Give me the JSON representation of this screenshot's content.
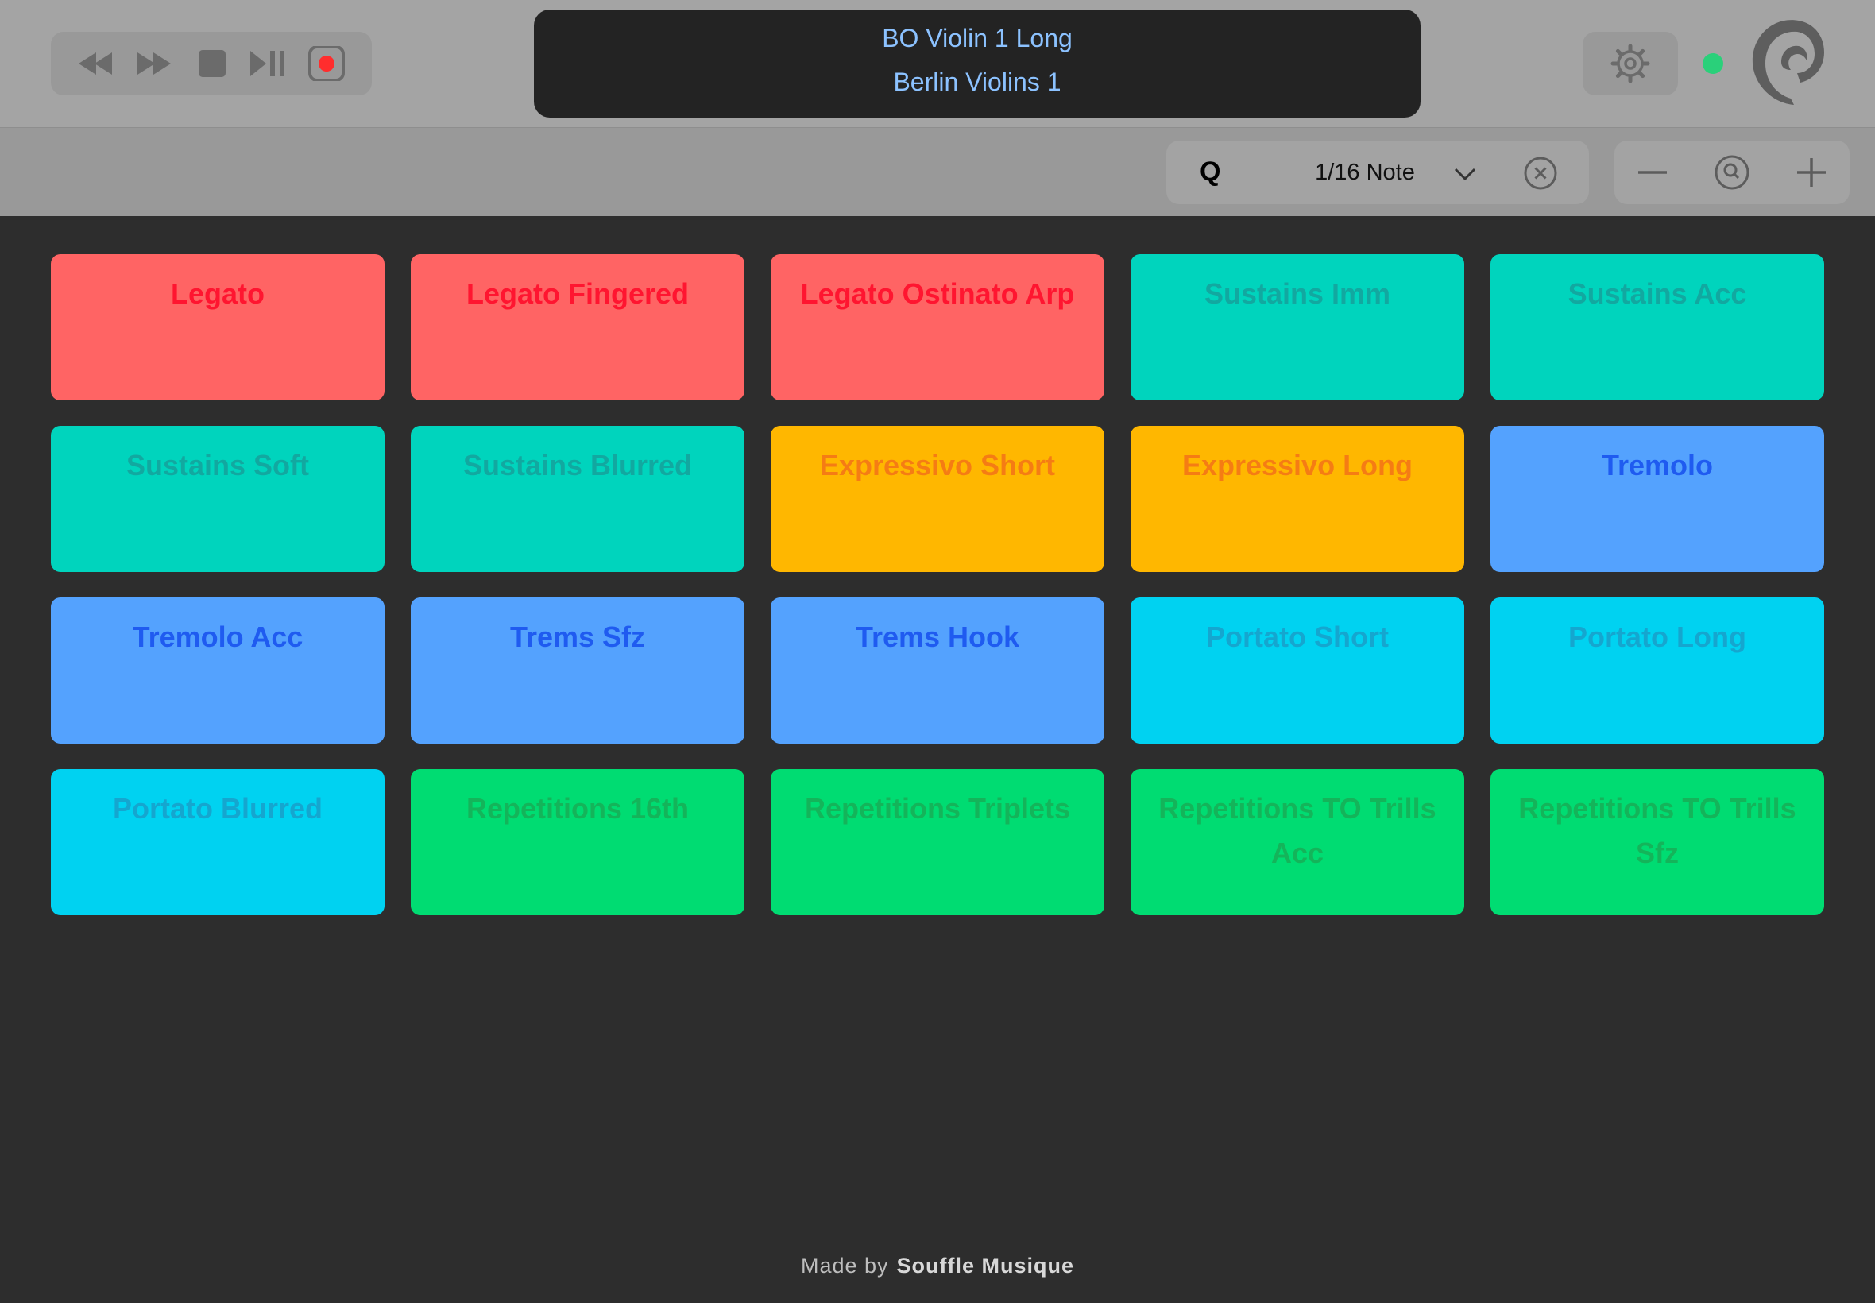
{
  "transport": {
    "buttons": [
      {
        "name": "rewind-button",
        "icon": "rewind-icon"
      },
      {
        "name": "fast-forward-button",
        "icon": "fast-forward-icon"
      },
      {
        "name": "stop-button",
        "icon": "stop-icon"
      },
      {
        "name": "play-pause-button",
        "icon": "play-pause-icon"
      },
      {
        "name": "record-button",
        "icon": "record-icon"
      }
    ],
    "record_color": "#ff2d2d",
    "icon_color": "#6b6b6b"
  },
  "display": {
    "articulation": "BO Violin 1 Long",
    "instrument": "Berlin Violins 1"
  },
  "status": {
    "connected_color": "#2ad07a"
  },
  "quantize": {
    "label": "Q",
    "value": "1/16 Note"
  },
  "zoom": {
    "out_icon": "minus-icon",
    "reset_icon": "zoom-magnifier-icon",
    "in_icon": "plus-icon"
  },
  "pads": [
    {
      "label": "Legato",
      "bg": "#ff6464",
      "fg": "#ff1530"
    },
    {
      "label": "Legato Fingered",
      "bg": "#ff6464",
      "fg": "#ff1530"
    },
    {
      "label": "Legato Ostinato Arp",
      "bg": "#ff6464",
      "fg": "#ff1530"
    },
    {
      "label": "Sustains Imm",
      "bg": "#00d4bd",
      "fg": "#12a8a0"
    },
    {
      "label": "Sustains Acc",
      "bg": "#00d4bd",
      "fg": "#12a8a0"
    },
    {
      "label": "Sustains Soft",
      "bg": "#00d4bd",
      "fg": "#12a8a0"
    },
    {
      "label": "Sustains Blurred",
      "bg": "#00d4bd",
      "fg": "#12a8a0"
    },
    {
      "label": "Expressivo Short",
      "bg": "#ffb700",
      "fg": "#f57c14"
    },
    {
      "label": "Expressivo Long",
      "bg": "#ffb700",
      "fg": "#f57c14"
    },
    {
      "label": "Tremolo",
      "bg": "#54a2fe",
      "fg": "#1f5bf0"
    },
    {
      "label": "Tremolo Acc",
      "bg": "#54a2fe",
      "fg": "#1f5bf0"
    },
    {
      "label": "Trems Sfz",
      "bg": "#54a2fe",
      "fg": "#1f5bf0"
    },
    {
      "label": "Trems Hook",
      "bg": "#54a2fe",
      "fg": "#1f5bf0"
    },
    {
      "label": "Portato Short",
      "bg": "#00d2f1",
      "fg": "#15a6cf"
    },
    {
      "label": "Portato Long",
      "bg": "#00d2f1",
      "fg": "#15a6cf"
    },
    {
      "label": "Portato Blurred",
      "bg": "#00d2f1",
      "fg": "#15a6cf"
    },
    {
      "label": "Repetitions 16th",
      "bg": "#00dc72",
      "fg": "#14b45a"
    },
    {
      "label": "Repetitions Triplets",
      "bg": "#00dc72",
      "fg": "#14b45a"
    },
    {
      "label": "Repetitions TO Trills Acc",
      "bg": "#00dc72",
      "fg": "#14b45a"
    },
    {
      "label": "Repetitions TO Trills Sfz",
      "bg": "#00dc72",
      "fg": "#14b45a"
    }
  ],
  "footer": {
    "made_by": "Made by",
    "brand": "Souffle Musique"
  }
}
